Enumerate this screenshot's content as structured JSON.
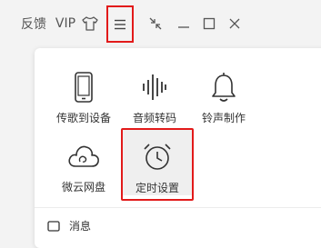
{
  "titlebar": {
    "feedback_label": "反馈",
    "vip_label": "VIP",
    "skin_icon": "tshirt-icon",
    "menu_icon": "hamburger-menu-icon",
    "shrink_icon": "shrink-icon",
    "minimize_icon": "minimize-icon",
    "maximize_icon": "maximize-icon",
    "close_icon": "close-icon"
  },
  "menu": {
    "items": [
      {
        "label": "传歌到设备",
        "icon": "phone-device-icon"
      },
      {
        "label": "音频转码",
        "icon": "audio-waveform-icon"
      },
      {
        "label": "铃声制作",
        "icon": "bell-icon"
      },
      {
        "label": "微云网盘",
        "icon": "cloud-icon"
      },
      {
        "label": "定时设置",
        "icon": "alarm-clock-icon"
      }
    ],
    "partial_item": {
      "label": "消息",
      "icon": "message-icon"
    }
  },
  "colors": {
    "highlight_border": "#e21a1a",
    "panel_bg": "#ffffff",
    "window_bg": "#f3f3f3",
    "selected_tile_bg": "#efefef"
  }
}
